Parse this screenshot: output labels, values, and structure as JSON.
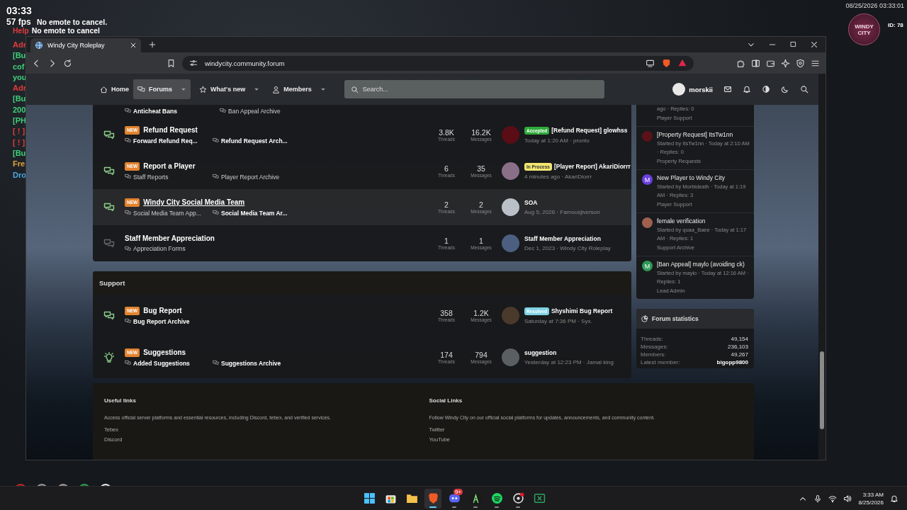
{
  "hud": {
    "clock": "03:33",
    "fps": "57 fps",
    "datetime": "08/25/2026 03:33:01",
    "id": "ID: 78",
    "logo": "WINDY CITY"
  },
  "chat": [
    {
      "text": "No emote to cancel."
    },
    {
      "prefix": "Help",
      "color": "#e23b3b",
      "text": "No emote to cancel"
    },
    {
      "prefix": "Adr",
      "color": "#e23b3b"
    },
    {
      "prefix": "[Bu",
      "color": "#3fd07a"
    },
    {
      "prefix": "cof",
      "color": "#3fd07a"
    },
    {
      "prefix": "you",
      "color": "#3fd07a"
    },
    {
      "prefix": "Adr",
      "color": "#e23b3b"
    },
    {
      "prefix": "[Bu",
      "color": "#3fd07a"
    },
    {
      "prefix": "200",
      "color": "#3fd07a"
    },
    {
      "prefix": "[PH",
      "color": "#3fd07a"
    },
    {
      "prefix": "[ ! ]",
      "color": "#e23b3b"
    },
    {
      "prefix": "[ ! ]",
      "color": "#e23b3b"
    },
    {
      "prefix": "[Bu",
      "color": "#3fd07a"
    },
    {
      "prefix": "Fre",
      "color": "#e0a53a"
    },
    {
      "prefix": "Dro",
      "color": "#4aa8e0"
    }
  ],
  "browser": {
    "tabs": [
      {
        "title": "Windy City Roleplay",
        "selected": true
      }
    ],
    "url": "windycity.community.forum"
  },
  "nav": {
    "items": [
      {
        "label": "Home",
        "kind": "home",
        "selected": false,
        "dropdown": false
      },
      {
        "label": "Forums",
        "kind": "chat",
        "selected": true,
        "dropdown": true
      },
      {
        "label": "What's new",
        "kind": "star",
        "selected": false,
        "dropdown": true
      },
      {
        "label": "Members",
        "kind": "person",
        "selected": false,
        "dropdown": true
      }
    ],
    "search": {
      "placeholder": "Search..."
    },
    "user": "morskii"
  },
  "categories": [
    {
      "top_subforums": [
        {
          "label": "Anticheat Bans",
          "unread": true
        },
        {
          "label": "Ban Appeal Archive",
          "unread": false
        }
      ],
      "nodes": [
        {
          "kind": "chat",
          "title": "Refund Request",
          "badge": "NEW",
          "unread": true,
          "hovered": false,
          "subforums": [
            {
              "label": "Forward Refund Req...",
              "unread": true
            },
            {
              "label": "Refund Request Arch...",
              "unread": true
            }
          ],
          "threads": {
            "value": "3.8K",
            "label": "Threads"
          },
          "messages": {
            "value": "16.2K",
            "label": "Messages"
          },
          "last": {
            "avatar": {
              "color": "#5a0d14"
            },
            "prefix": {
              "label": "Accepted",
              "color": "#2eaa3a"
            },
            "title": "[Refund Request] glowhss",
            "meta": "Today at 1:20 AM · pronto"
          }
        },
        {
          "kind": "chat",
          "title": "Report a Player",
          "badge": "NEW",
          "unread": true,
          "hovered": false,
          "subforums": [
            {
              "label": "Staff Reports",
              "unread": false
            },
            {
              "label": "Player Report Archive",
              "unread": false
            }
          ],
          "threads": {
            "value": "6",
            "label": "Threads"
          },
          "messages": {
            "value": "35",
            "label": "Messages"
          },
          "last": {
            "avatar": {
              "color": "#8a6f88"
            },
            "prefix": {
              "label": "In Process",
              "color": "#f3e772"
            },
            "title": "[Player Report] AkariDiorrr",
            "meta": "4 minutes ago · AkariDiorrr"
          }
        },
        {
          "kind": "chat",
          "title": "Windy City Social Media Team",
          "badge": "NEW",
          "unread": true,
          "hovered": true,
          "subforums": [
            {
              "label": "Social Media Team App...",
              "unread": false
            },
            {
              "label": "Social Media Team Ar...",
              "unread": true
            }
          ],
          "threads": {
            "value": "2",
            "label": "Threads"
          },
          "messages": {
            "value": "2",
            "label": "Messages"
          },
          "last": {
            "avatar": {
              "color": "#b9c0c8"
            },
            "title": "SOA",
            "meta": "Aug 5, 2026 · Famousjiverson"
          }
        },
        {
          "kind": "chat",
          "title": "Staff Member Appreciation",
          "unread": false,
          "hovered": false,
          "subforums": [
            {
              "label": "Appreciation Forms",
              "unread": false
            }
          ],
          "threads": {
            "value": "1",
            "label": "Threads"
          },
          "messages": {
            "value": "1",
            "label": "Messages"
          },
          "last": {
            "avatar": {
              "color": "#4d5f80"
            },
            "title": "Staff Member Appreciation",
            "meta": "Dec 1, 2023 · Windy City Roleplay"
          }
        }
      ]
    },
    {
      "title": "Support",
      "nodes": [
        {
          "kind": "chat",
          "title": "Bug Report",
          "badge": "NEW",
          "unread": true,
          "hovered": false,
          "subforums": [
            {
              "label": "Bug Report Archive",
              "unread": true
            }
          ],
          "threads": {
            "value": "358",
            "label": "Threads"
          },
          "messages": {
            "value": "1.2K",
            "label": "Messages"
          },
          "last": {
            "avatar": {
              "color": "#4a3a2c"
            },
            "prefix": {
              "label": "Resolved",
              "color": "#7fd3e3"
            },
            "title": "Shyshimi Bug Report",
            "meta": "Saturday at 7:36 PM · Syx."
          }
        },
        {
          "kind": "bulb",
          "title": "Suggestions",
          "badge": "NEW",
          "unread": true,
          "hovered": false,
          "subforums": [
            {
              "label": "Added Suggestions",
              "unread": true
            },
            {
              "label": "Suggestions Archive",
              "unread": true
            }
          ],
          "threads": {
            "value": "174",
            "label": "Threads"
          },
          "messages": {
            "value": "794",
            "label": "Messages"
          },
          "last": {
            "avatar": {
              "color": "#5a5f62"
            },
            "title": "suggestion",
            "meta": "Yesterday at 12:23 PM · Jamal king"
          }
        }
      ]
    }
  ],
  "new_posts": [
    {
      "meta": "ago · Replies: 0",
      "forum": "Player Support"
    },
    {
      "title": "[Property Request] ItsTw1nn",
      "meta": "Started by ItsTw1nn · Today at 2:10 AM · Replies: 0",
      "forum": "Property Requests",
      "avatar": {
        "color": "#5a1218"
      }
    },
    {
      "title": "New Player to Windy City",
      "meta": "Started by Morbideath · Today at 1:19 AM · Replies: 3",
      "forum": "Player Support",
      "avatar": {
        "letter": "M",
        "color": "#6a3fe0"
      }
    },
    {
      "title": "female verification",
      "meta": "Started by quaa_Baee · Today at 1:17 AM · Replies: 1",
      "forum": "Support Archive",
      "avatar": {
        "color": "#a0604e"
      }
    },
    {
      "title": "[Ban Appeal] maylo (avoiding ck)",
      "meta": "Started by maylo · Today at 12:16 AM · Replies: 1",
      "forum": "Lead Admin",
      "avatar": {
        "letter": "M",
        "color": "#2e9a55"
      }
    }
  ],
  "stats": {
    "title": "Forum statistics",
    "rows": [
      {
        "label": "Threads:",
        "value": "49,154"
      },
      {
        "label": "Messages:",
        "value": "236,103"
      },
      {
        "label": "Members:",
        "value": "49,267"
      },
      {
        "label": "Latest member:",
        "value": "bigopp9800"
      }
    ]
  },
  "footer": [
    {
      "title": "Useful links",
      "text": "Access official server platforms and essential resources, including Discord, tebex, and verified services.",
      "links": [
        "Tebex",
        "Discord"
      ]
    },
    {
      "title": "Social Links",
      "text": "Follow Windy City on our official social platforms for updates, announcements, and community content.",
      "links": [
        "Twitter",
        "YouTube"
      ]
    }
  ],
  "taskbar": {
    "apps": [
      {
        "kind": "start",
        "running": false
      },
      {
        "kind": "store",
        "running": false
      },
      {
        "kind": "folder",
        "running": false
      },
      {
        "kind": "brave",
        "running": true,
        "selected": true
      },
      {
        "kind": "discord",
        "running": true,
        "selected": false,
        "badge": "9+"
      },
      {
        "kind": "figure",
        "running": true,
        "selected": false
      },
      {
        "kind": "spotify",
        "running": true,
        "selected": false
      },
      {
        "kind": "ring",
        "running": true,
        "selected": false
      },
      {
        "kind": "xbox",
        "running": false
      }
    ],
    "time": "3:33 AM",
    "date": "8/25/2026"
  }
}
